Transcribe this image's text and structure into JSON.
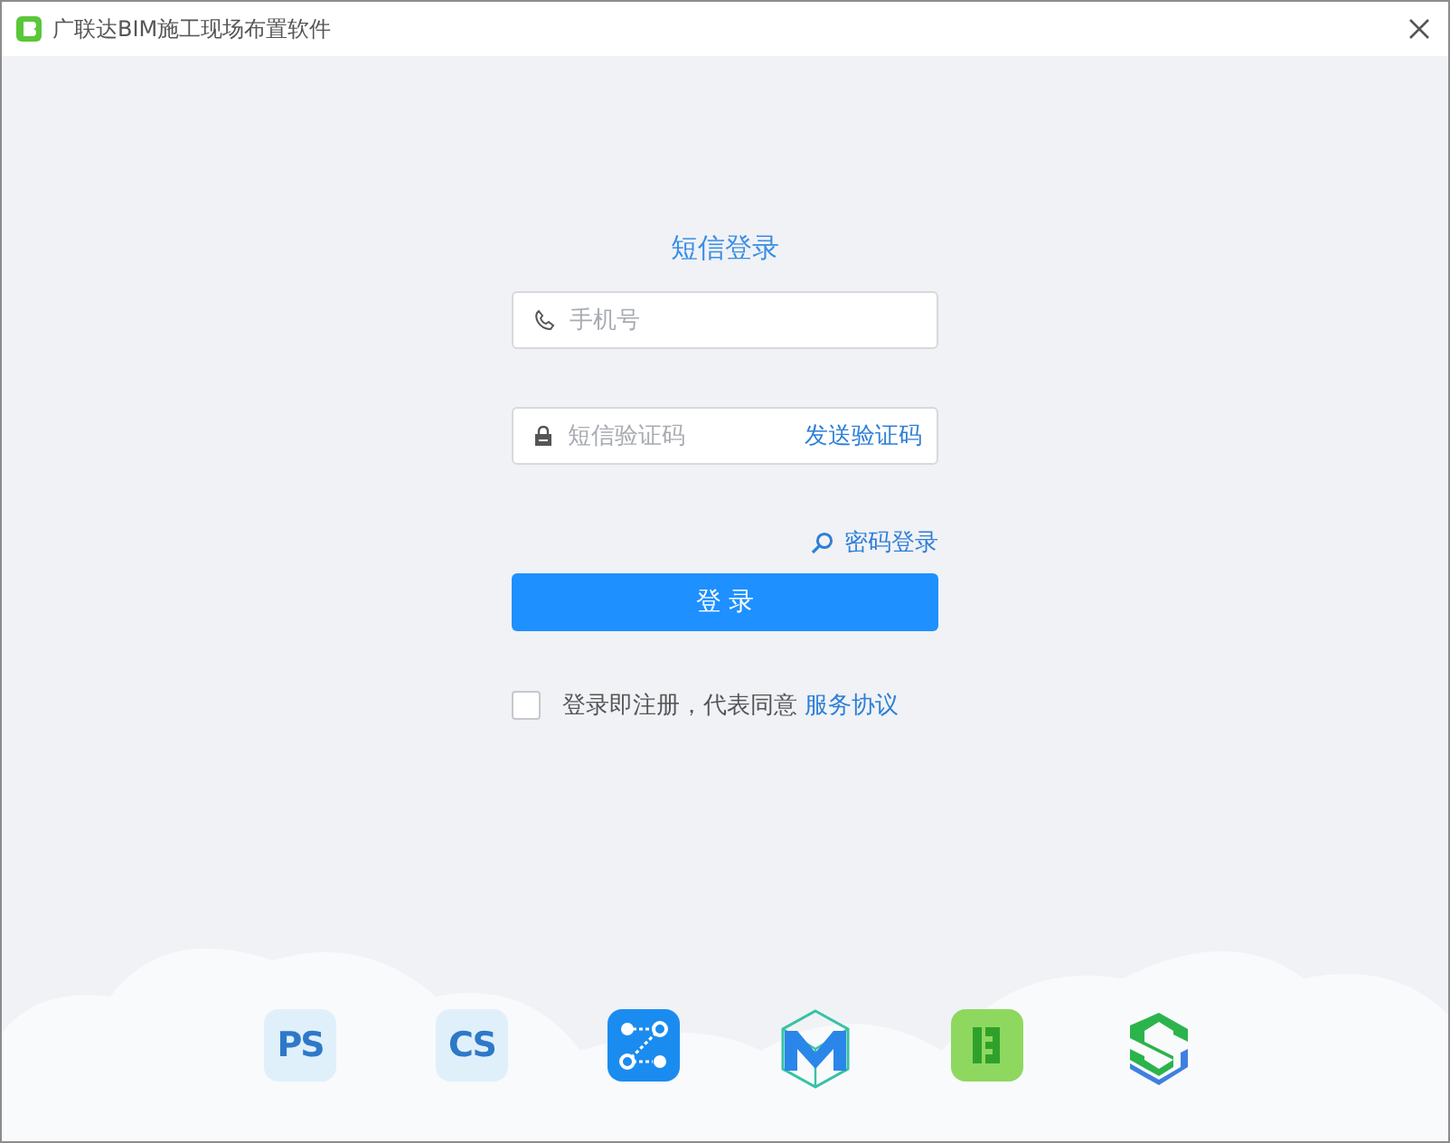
{
  "window": {
    "title": "广联达BIM施工现场布置软件"
  },
  "login": {
    "heading": "短信登录",
    "phone_field": {
      "placeholder": "手机号"
    },
    "code_field": {
      "placeholder": "短信验证码",
      "send_code_link": "发送验证码"
    },
    "password_login_link": "密码登录",
    "submit_button": "登 录",
    "agreement": {
      "checked": false,
      "text": "登录即注册，代表同意",
      "link": "服务协议"
    }
  },
  "app_icons": [
    {
      "kind": "lettered",
      "label": "PS"
    },
    {
      "kind": "lettered",
      "label": "CS"
    },
    {
      "kind": "flow"
    },
    {
      "kind": "cube"
    },
    {
      "kind": "green"
    },
    {
      "kind": "blocks"
    }
  ]
}
